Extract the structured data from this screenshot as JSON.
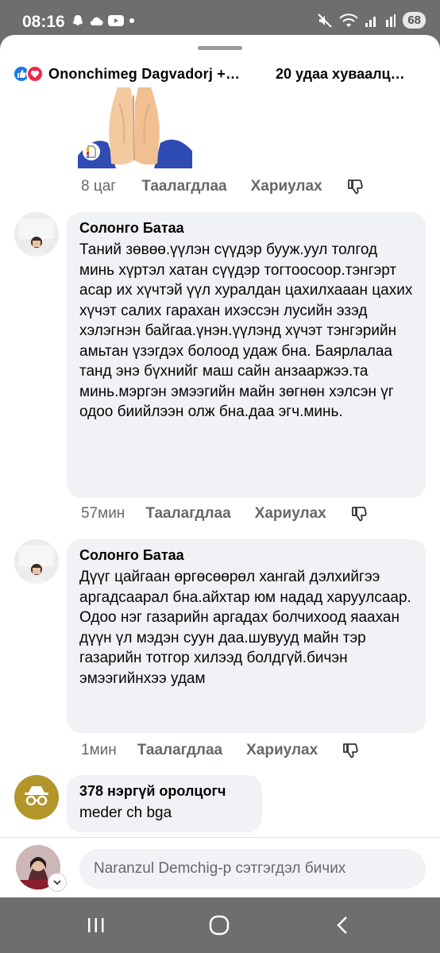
{
  "status": {
    "time": "08:16",
    "battery": "68"
  },
  "reactions": {
    "names": "Ononchimeg Dagvadorj +…",
    "shares": "20 удаа хуваалц…"
  },
  "comments": [
    {
      "time": "8 цаг",
      "like_label": "Таалагдлаа",
      "reply_label": "Хариулах"
    },
    {
      "author": "Солонго Батаа",
      "text": "Таний зөвөө.үүлэн сүүдэр бууж.уул толгод минь хүртэл хатан сүүдэр тогтоосоор.тэнгэрт асар их хүчтэй үүл хуралдан цахилхааан цахих хүчэт салих гарахан ихэссэн лусийн эзэд хэлэгнэн байгаа.үнэн.үүлэнд хүчэт тэнгэрийн амьтан үзэгдэх болоод удаж бна. Баярлалаа танд энэ бүхнийг маш сайн анзааржээ.та минь.мэргэн эмээгийн майн зөгнөн хэлсэн үг одоо биийлээн олж бна.даа эгч.минь.",
      "time": "57мин",
      "like_label": "Таалагдлаа",
      "reply_label": "Хариулах"
    },
    {
      "author": "Солонго Батаа",
      "text": "Дүүг цайгаан өргөсөөрөл хангай дэлхийгээ аргадсаарал бна.айхтар юм надад харуулсаар. Одоо нэг газарийн аргадах болчихоод яаахан дүүн үл мэдэн суун даа.шувууд майн тэр газарийн тотгор хилээд болдгүй.бичэн эмээгийнхээ удам",
      "time": "1мин",
      "like_label": "Таалагдлаа",
      "reply_label": "Хариулах"
    },
    {
      "author": "378 нэргүй оролцогч",
      "text": "meder ch bga"
    }
  ],
  "composer": {
    "placeholder": "Naranzul Demchig-р сэтгэгдэл бичих"
  },
  "colors": {
    "like_blue": "#1877f2",
    "love_red": "#f02849",
    "bubble_bg": "#f0f2f5",
    "meta_gray": "#65676b"
  }
}
